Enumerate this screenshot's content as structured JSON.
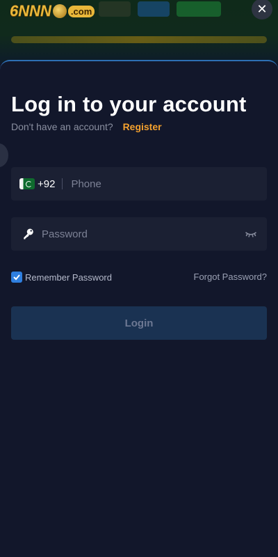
{
  "app": {
    "logo_text": "6NNN",
    "logo_suffix": ".com"
  },
  "modal": {
    "close_label": "✕",
    "title": "Log in to your account",
    "no_account_text": "Don't have an account?",
    "register_link": "Register",
    "phone": {
      "country_code": "+92",
      "placeholder": "Phone",
      "flag": "pakistan-flag"
    },
    "password": {
      "placeholder": "Password",
      "icon": "key-icon",
      "toggle_icon": "eye-closed-icon"
    },
    "remember": {
      "label": "Remember Password",
      "checked": true
    },
    "forgot_link": "Forgot Password?",
    "login_button": "Login"
  },
  "colors": {
    "background": "#12172b",
    "field": "#1b2033",
    "accent_orange": "#f4a12e",
    "checkbox_blue": "#2f7fe0",
    "login_button_bg": "#1a3252"
  }
}
